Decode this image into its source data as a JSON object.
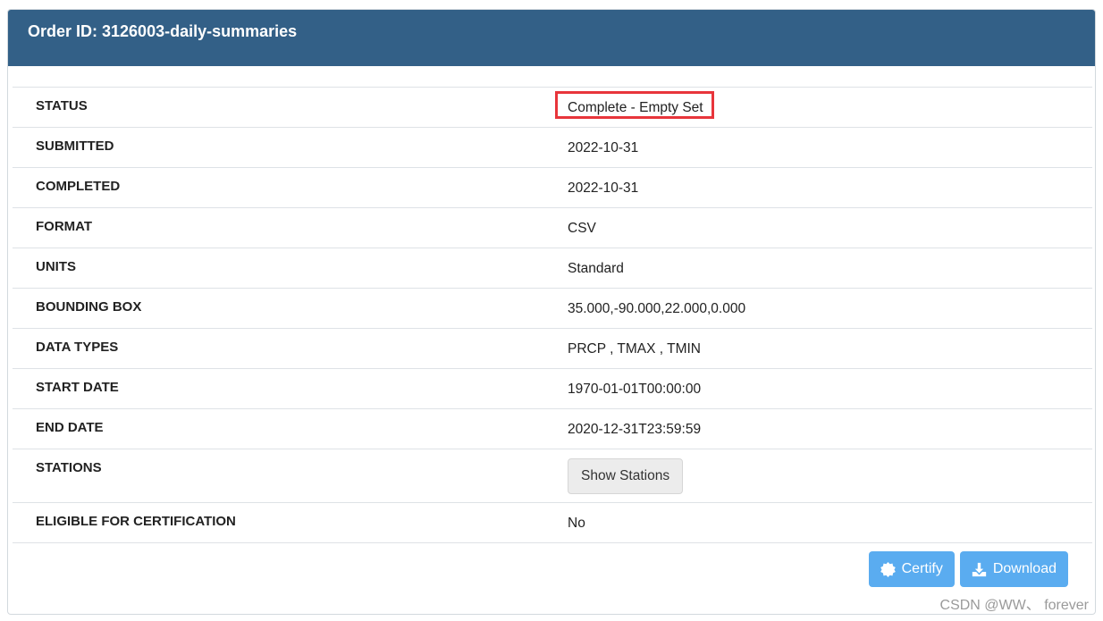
{
  "header": {
    "title": "Order ID: 3126003-daily-summaries"
  },
  "rows": [
    {
      "label": "STATUS",
      "value": "Complete - Empty Set"
    },
    {
      "label": "SUBMITTED",
      "value": "2022-10-31"
    },
    {
      "label": "COMPLETED",
      "value": "2022-10-31"
    },
    {
      "label": "FORMAT",
      "value": "CSV"
    },
    {
      "label": "UNITS",
      "value": "Standard"
    },
    {
      "label": "BOUNDING BOX",
      "value": "35.000,-90.000,22.000,0.000"
    },
    {
      "label": "DATA TYPES",
      "value": "PRCP , TMAX , TMIN"
    },
    {
      "label": "START DATE",
      "value": "1970-01-01T00:00:00"
    },
    {
      "label": "END DATE",
      "value": "2020-12-31T23:59:59"
    },
    {
      "label": "STATIONS",
      "button_label": "Show Stations"
    },
    {
      "label": "ELIGIBLE FOR CERTIFICATION",
      "value": "No"
    }
  ],
  "actions": {
    "certify_label": "Certify",
    "download_label": "Download",
    "certify_icon": "badge-icon",
    "download_icon": "download-icon"
  },
  "watermark": "CSDN @WW、 forever",
  "colors": {
    "header_bg": "#336087",
    "button_bg": "#5aacf0",
    "highlight_border": "#e8353b"
  }
}
